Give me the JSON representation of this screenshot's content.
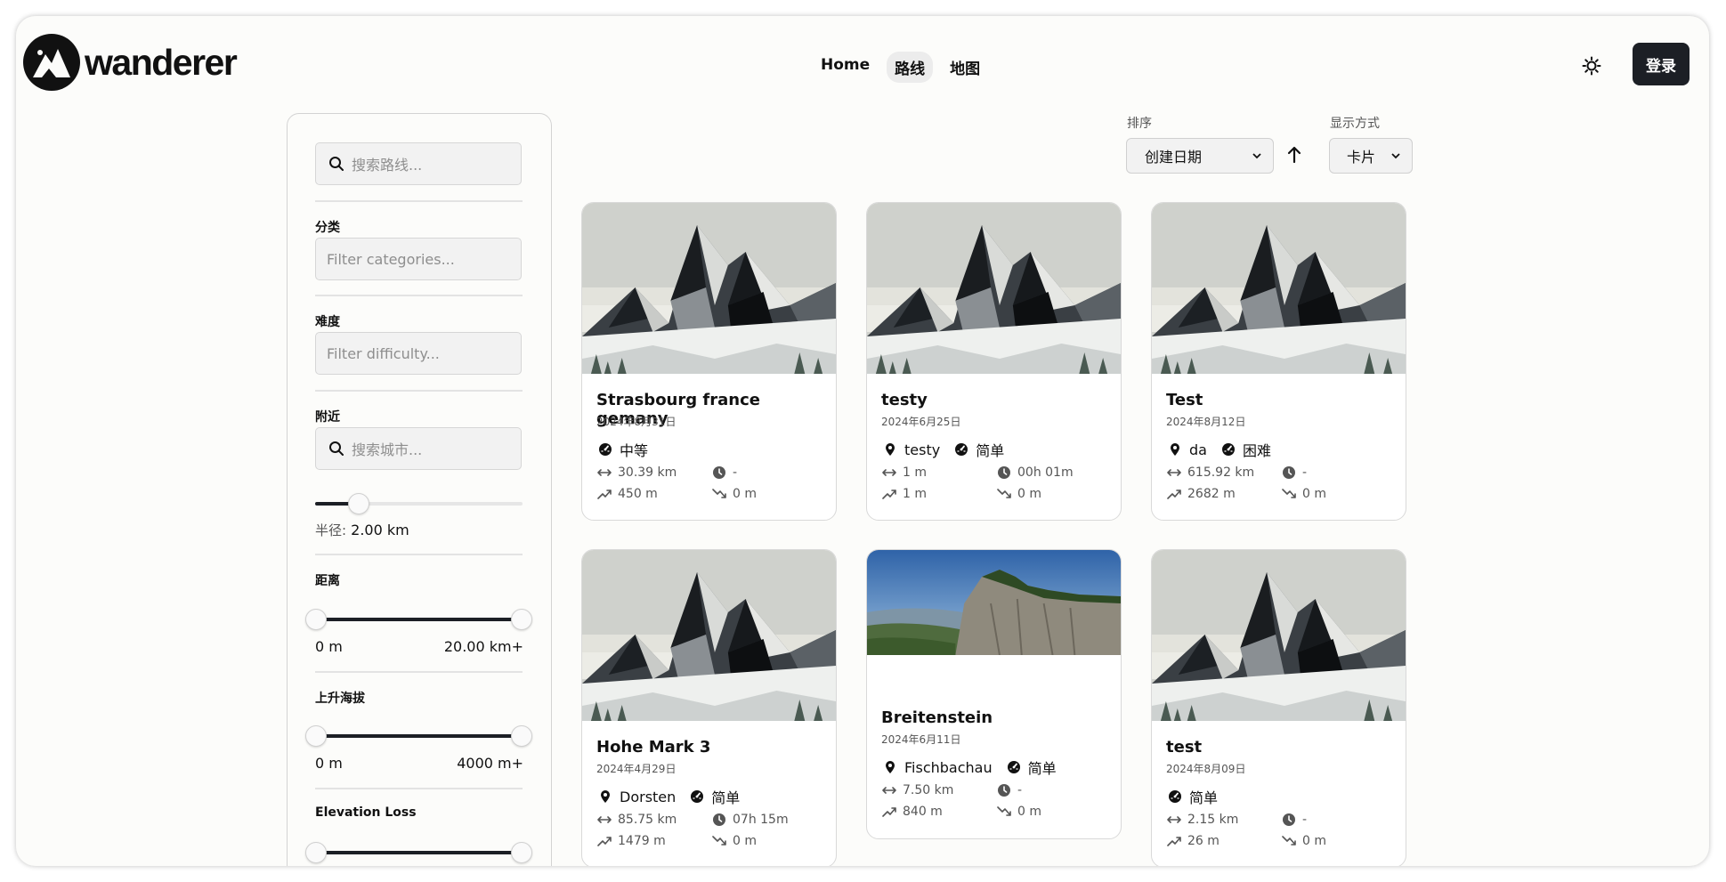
{
  "app": {
    "name": "wanderer"
  },
  "nav": {
    "items": [
      {
        "label": "Home",
        "active": false
      },
      {
        "label": "路线",
        "active": true
      },
      {
        "label": "地图",
        "active": false
      }
    ]
  },
  "header": {
    "login_label": "登录",
    "theme_icon": "sun-icon"
  },
  "sidebar": {
    "search_placeholder": "搜索路线...",
    "category_label": "分类",
    "category_placeholder": "Filter categories...",
    "difficulty_label": "难度",
    "difficulty_placeholder": "Filter difficulty...",
    "nearby_label": "附近",
    "city_placeholder": "搜索城市...",
    "radius_label": "半径:",
    "radius_value": "2.00 km",
    "radius_fraction": 0.21,
    "distance_label": "距离",
    "distance_min": "0 m",
    "distance_max": "20.00 km+",
    "elevation_gain_label": "上升海拔",
    "elevation_gain_min": "0 m",
    "elevation_gain_max": "4000 m+",
    "elevation_loss_label": "Elevation Loss"
  },
  "controls": {
    "sort_label": "排序",
    "sort_value": "创建日期",
    "sort_direction_icon": "arrow-up-icon",
    "display_label": "显示方式",
    "display_value": "卡片"
  },
  "trails": [
    {
      "title": "Strasbourg france gemany",
      "date": "2024年8月31日",
      "location": "",
      "difficulty": "中等",
      "distance": "30.39 km",
      "duration": "-",
      "gain": "450 m",
      "loss": "0 m",
      "image": "mountain"
    },
    {
      "title": "testy",
      "date": "2024年6月25日",
      "location": "testy",
      "difficulty": "简单",
      "distance": "1 m",
      "duration": "00h 01m",
      "gain": "1 m",
      "loss": "0 m",
      "image": "mountain"
    },
    {
      "title": "Test",
      "date": "2024年8月12日",
      "location": "da",
      "difficulty": "困难",
      "distance": "615.92 km",
      "duration": "-",
      "gain": "2682 m",
      "loss": "0 m",
      "image": "mountain"
    },
    {
      "title": "Hohe Mark 3",
      "date": "2024年4月29日",
      "location": "Dorsten",
      "difficulty": "简单",
      "distance": "85.75 km",
      "duration": "07h 15m",
      "gain": "1479 m",
      "loss": "0 m",
      "image": "mountain"
    },
    {
      "title": "Breitenstein",
      "date": "2024年6月11日",
      "location": "Fischbachau",
      "difficulty": "简单",
      "distance": "7.50 km",
      "duration": "-",
      "gain": "840 m",
      "loss": "0 m",
      "image": "photo"
    },
    {
      "title": "test",
      "date": "2024年8月09日",
      "location": "",
      "difficulty": "简单",
      "distance": "2.15 km",
      "duration": "-",
      "gain": "26 m",
      "loss": "0 m",
      "image": "mountain"
    }
  ],
  "colors": {
    "primary": "#1c1f25",
    "background": "#fcfcfa",
    "card_border": "#d9d9d9"
  }
}
